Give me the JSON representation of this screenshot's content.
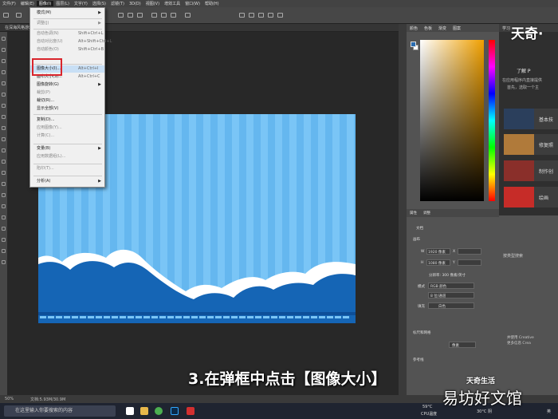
{
  "menubar": {
    "items": [
      "文件(F)",
      "编辑(E)",
      "图像(I)",
      "图层(L)",
      "文字(Y)",
      "选择(S)",
      "滤镜(T)",
      "3D(D)",
      "视图(V)",
      "增效工具",
      "窗口(W)",
      "帮助(H)"
    ]
  },
  "document": {
    "tab_title": "在深海风格游戏图片设计.psd @ 50% (RGB/8)"
  },
  "image_menu": {
    "items": [
      {
        "label": "模式(M)",
        "shortcut": "",
        "submenu": true,
        "disabled": false
      },
      {
        "label": "调整(J)",
        "shortcut": "",
        "submenu": true,
        "disabled": true
      },
      {
        "label": "自动色调(N)",
        "shortcut": "Shift+Ctrl+L",
        "submenu": false,
        "disabled": true
      },
      {
        "label": "自动对比度(U)",
        "shortcut": "Alt+Shift+Ctrl+L",
        "submenu": false,
        "disabled": true
      },
      {
        "label": "自动颜色(O)",
        "shortcut": "Shift+Ctrl+B",
        "submenu": false,
        "disabled": true
      },
      {
        "label": "图像大小(I)...",
        "shortcut": "Alt+Ctrl+I",
        "submenu": false,
        "disabled": false,
        "highlighted": true
      },
      {
        "label": "画布大小(S)...",
        "shortcut": "Alt+Ctrl+C",
        "submenu": false,
        "disabled": false
      },
      {
        "label": "图像旋转(G)",
        "shortcut": "",
        "submenu": true,
        "disabled": false
      },
      {
        "label": "裁剪(P)",
        "shortcut": "",
        "submenu": false,
        "disabled": true
      },
      {
        "label": "裁切(R)...",
        "shortcut": "",
        "submenu": false,
        "disabled": false
      },
      {
        "label": "显示全部(V)",
        "shortcut": "",
        "submenu": false,
        "disabled": false
      },
      {
        "label": "复制(D)...",
        "shortcut": "",
        "submenu": false,
        "disabled": false
      },
      {
        "label": "应用图像(Y)...",
        "shortcut": "",
        "submenu": false,
        "disabled": true
      },
      {
        "label": "计算(C)...",
        "shortcut": "",
        "submenu": false,
        "disabled": true
      },
      {
        "label": "变量(B)",
        "shortcut": "",
        "submenu": true,
        "disabled": false
      },
      {
        "label": "应用数据组(L)...",
        "shortcut": "",
        "submenu": false,
        "disabled": true
      },
      {
        "label": "陷印(T)...",
        "shortcut": "",
        "submenu": false,
        "disabled": true
      },
      {
        "label": "分析(A)",
        "shortcut": "",
        "submenu": true,
        "disabled": false
      }
    ]
  },
  "color_panel": {
    "tabs": [
      "颜色",
      "色板",
      "渐变",
      "图案"
    ]
  },
  "properties_panel": {
    "tabs": [
      "属性",
      "调整"
    ],
    "section_doc": "文档",
    "section_canvas": "画布",
    "w_label": "W",
    "w_value": "1920 像素",
    "x_label": "X",
    "h_label": "H",
    "h_value": "1080 像素",
    "y_label": "Y",
    "resolution": "分辨率: 300 像素/英寸",
    "mode_label": "模式",
    "mode_value": "RGB 颜色",
    "depth_value": "8 位/通道",
    "fill_label": "填充",
    "fill_value": "白色",
    "rulers_section": "标尺和网格",
    "rulers_unit": "像素",
    "guides_section": "参考线"
  },
  "learn_panel": {
    "tab": "学习",
    "heading": "了解 P",
    "line1": "在应用程序内直接提供",
    "line2": "首先，选取一个主",
    "cards": [
      {
        "label": "基本技",
        "color": "#2b3f5c"
      },
      {
        "label": "修复照",
        "color": "#b07a3a"
      },
      {
        "label": "制作创",
        "color": "#8a2f2a"
      },
      {
        "label": "绘画",
        "color": "#c62c28"
      }
    ],
    "lower_label": "按类型搜索",
    "footer_line1": "并使用 Creative",
    "footer_line2": "更多信息 Crea"
  },
  "statusbar": {
    "zoom": "50%",
    "doc_info": "文档:5.93M/30.9M"
  },
  "taskbar": {
    "search_placeholder": "在这里输入你要搜索的内容",
    "weather": "30°C 阴",
    "cpu": "59°C",
    "cpu_label": "CPU温度",
    "lang": "英"
  },
  "caption": "3.在弹框中点击【图像大小】",
  "watermarks": {
    "top": "天奇·",
    "brand": "天奇生活",
    "bottom": "易坊好文馆"
  }
}
